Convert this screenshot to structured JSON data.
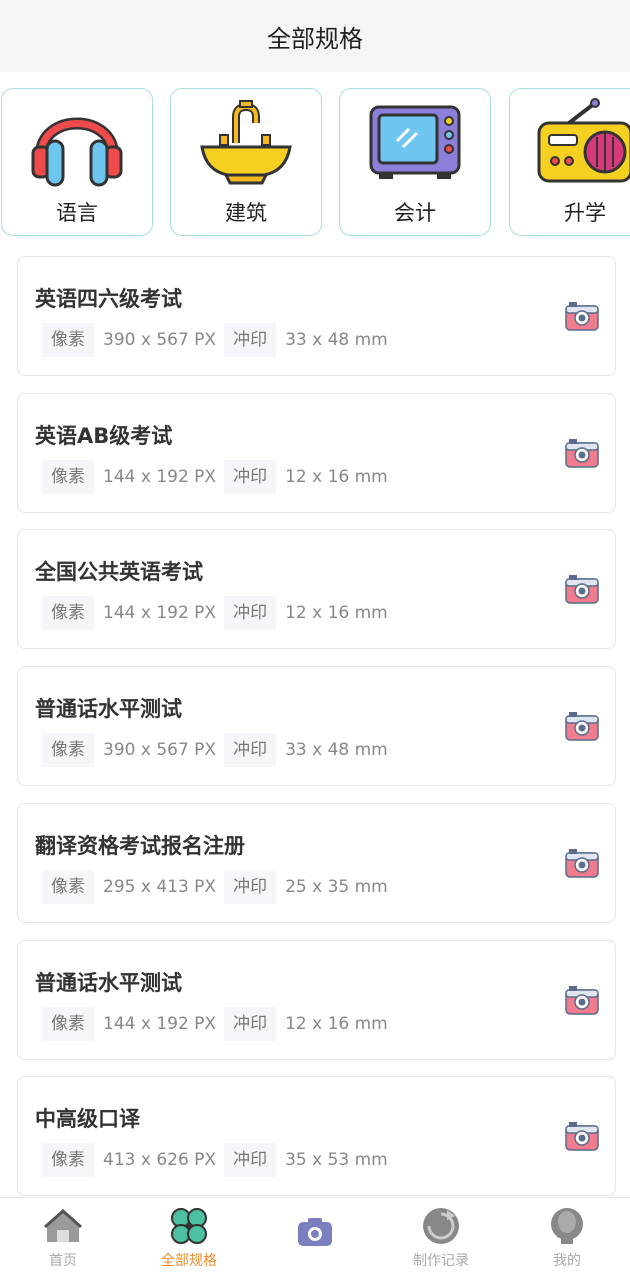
{
  "header": {
    "title": "全部规格"
  },
  "categories": [
    {
      "label": "语言",
      "icon": "headphones-icon"
    },
    {
      "label": "建筑",
      "icon": "sink-faucet-icon"
    },
    {
      "label": "会计",
      "icon": "microwave-icon"
    },
    {
      "label": "升学",
      "icon": "radio-icon"
    }
  ],
  "spec_labels": {
    "pixel": "像素",
    "print": "冲印"
  },
  "items": [
    {
      "title": "英语四六级考试",
      "pixel": "390 x 567 PX",
      "print": "33 x 48 mm"
    },
    {
      "title": "英语AB级考试",
      "pixel": "144 x 192 PX",
      "print": "12 x 16 mm"
    },
    {
      "title": "全国公共英语考试",
      "pixel": "144 x 192 PX",
      "print": "12 x 16 mm"
    },
    {
      "title": "普通话水平测试",
      "pixel": "390 x 567 PX",
      "print": "33 x 48 mm"
    },
    {
      "title": "翻译资格考试报名注册",
      "pixel": "295 x 413 PX",
      "print": "25 x 35 mm"
    },
    {
      "title": "普通话水平测试",
      "pixel": "144 x 192 PX",
      "print": "12 x 16 mm"
    },
    {
      "title": "中高级口译",
      "pixel": "413 x 626 PX",
      "print": "35 x 53 mm"
    }
  ],
  "tabbar": [
    {
      "label": "首页",
      "icon": "home-icon",
      "active": false
    },
    {
      "label": "全部规格",
      "icon": "clover-icon",
      "active": true
    },
    {
      "label": "",
      "icon": "camera-icon",
      "active": false
    },
    {
      "label": "制作记录",
      "icon": "record-icon",
      "active": false
    },
    {
      "label": "我的",
      "icon": "profile-icon",
      "active": false
    }
  ],
  "colors": {
    "accent": "#f08c2e",
    "border": "#a8dde3",
    "camera": "#f07c8e"
  }
}
